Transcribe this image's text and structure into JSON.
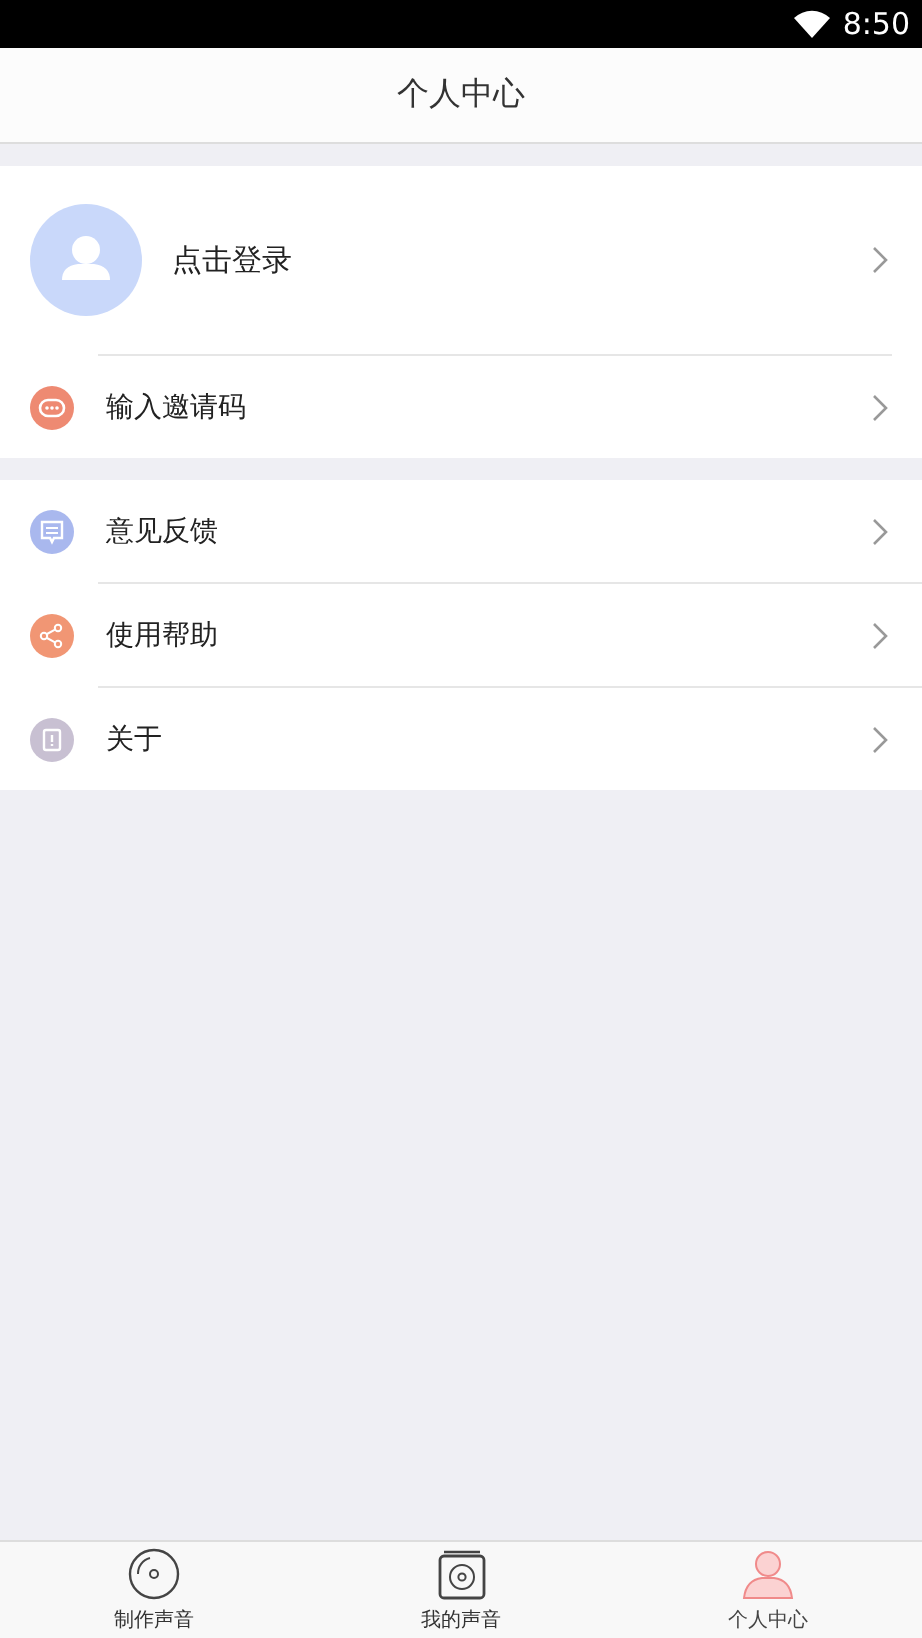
{
  "status_bar": {
    "time": "8:50"
  },
  "header": {
    "title": "个人中心"
  },
  "login": {
    "label": "点击登录"
  },
  "groups": [
    [
      {
        "label": "输入邀请码",
        "kind": "invite",
        "color": "#ee8a72"
      }
    ],
    [
      {
        "label": "意见反馈",
        "kind": "feedback",
        "color": "#a9b8ee"
      },
      {
        "label": "使用帮助",
        "kind": "help",
        "color": "#f19674"
      },
      {
        "label": "关于",
        "kind": "about",
        "color": "#c8c0d2"
      }
    ]
  ],
  "tabs": [
    {
      "label": "制作声音",
      "kind": "disc",
      "selected": false
    },
    {
      "label": "我的声音",
      "kind": "album",
      "selected": false
    },
    {
      "label": "个人中心",
      "kind": "person",
      "selected": true
    }
  ]
}
